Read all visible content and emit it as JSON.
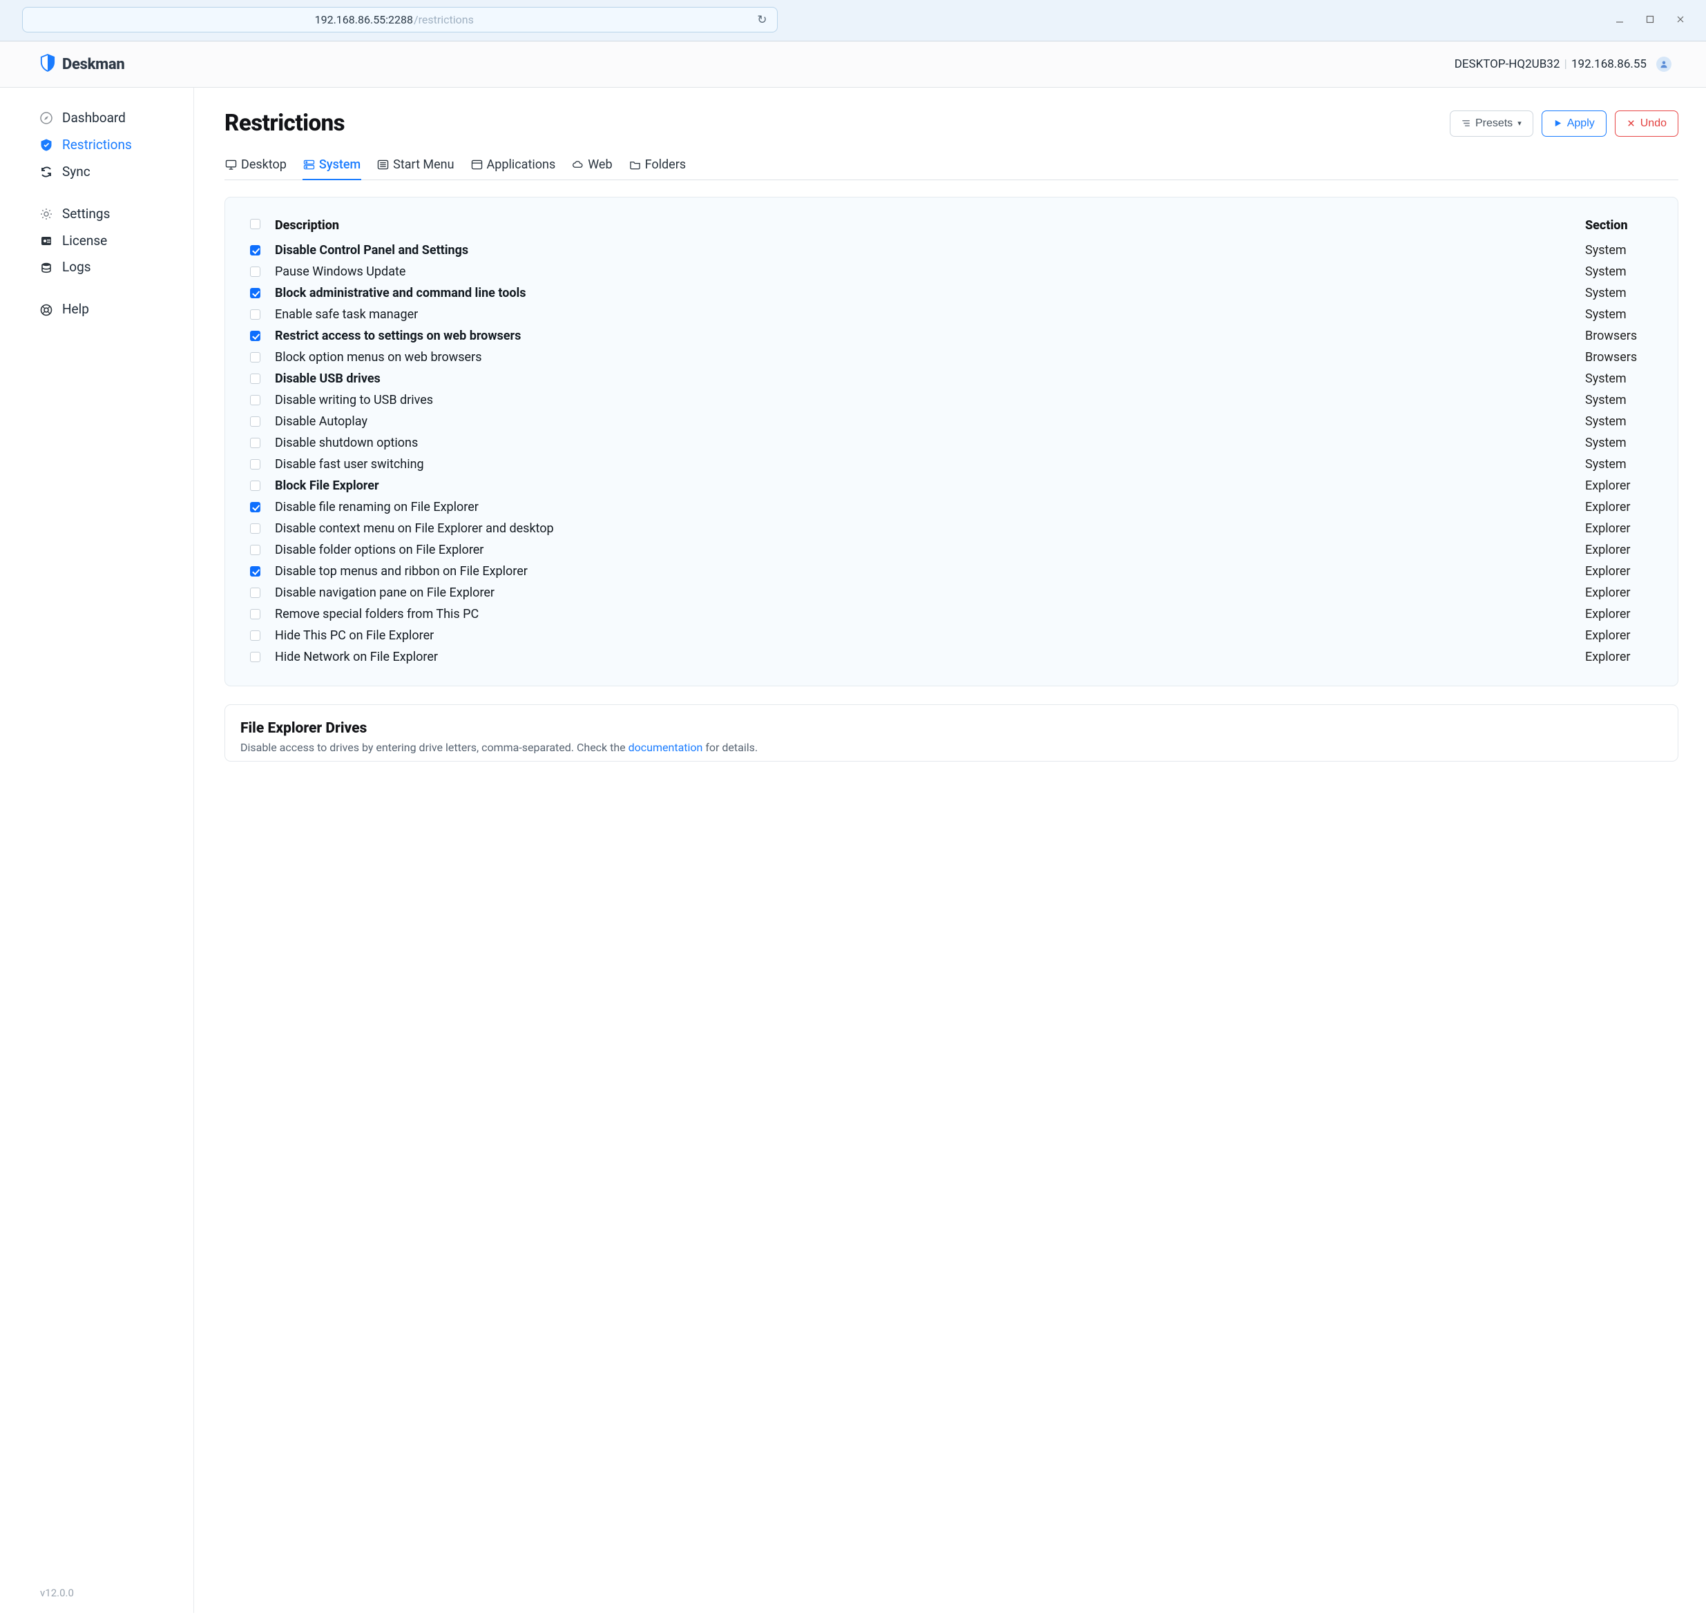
{
  "browser": {
    "url_main": "192.168.86.55:2288",
    "url_path": "/restrictions"
  },
  "brand": "Deskman",
  "host": {
    "name": "DESKTOP-HQ2UB32",
    "ip": "192.168.86.55"
  },
  "sidebar": {
    "items": [
      {
        "label": "Dashboard"
      },
      {
        "label": "Restrictions"
      },
      {
        "label": "Sync"
      },
      {
        "label": "Settings"
      },
      {
        "label": "License"
      },
      {
        "label": "Logs"
      },
      {
        "label": "Help"
      }
    ],
    "version": "v12.0.0"
  },
  "page": {
    "title": "Restrictions",
    "presets_label": "Presets",
    "apply_label": "Apply",
    "undo_label": "Undo"
  },
  "tabs": [
    {
      "label": "Desktop"
    },
    {
      "label": "System"
    },
    {
      "label": "Start Menu"
    },
    {
      "label": "Applications"
    },
    {
      "label": "Web"
    },
    {
      "label": "Folders"
    }
  ],
  "table": {
    "col_desc": "Description",
    "col_sec": "Section",
    "rows": [
      {
        "checked": true,
        "bold": true,
        "desc": "Disable Control Panel and Settings",
        "section": "System"
      },
      {
        "checked": false,
        "bold": false,
        "desc": "Pause Windows Update",
        "section": "System"
      },
      {
        "checked": true,
        "bold": true,
        "desc": "Block administrative and command line tools",
        "section": "System"
      },
      {
        "checked": false,
        "bold": false,
        "desc": "Enable safe task manager",
        "section": "System"
      },
      {
        "checked": true,
        "bold": true,
        "desc": "Restrict access to settings on web browsers",
        "section": "Browsers"
      },
      {
        "checked": false,
        "bold": false,
        "desc": "Block option menus on web browsers",
        "section": "Browsers"
      },
      {
        "checked": false,
        "bold": true,
        "desc": "Disable USB drives",
        "section": "System"
      },
      {
        "checked": false,
        "bold": false,
        "desc": "Disable writing to USB drives",
        "section": "System"
      },
      {
        "checked": false,
        "bold": false,
        "desc": "Disable Autoplay",
        "section": "System"
      },
      {
        "checked": false,
        "bold": false,
        "desc": "Disable shutdown options",
        "section": "System"
      },
      {
        "checked": false,
        "bold": false,
        "desc": "Disable fast user switching",
        "section": "System"
      },
      {
        "checked": false,
        "bold": true,
        "desc": "Block File Explorer",
        "section": "Explorer"
      },
      {
        "checked": true,
        "bold": false,
        "desc": "Disable file renaming on File Explorer",
        "section": "Explorer"
      },
      {
        "checked": false,
        "bold": false,
        "desc": "Disable context menu on File Explorer and desktop",
        "section": "Explorer"
      },
      {
        "checked": false,
        "bold": false,
        "desc": "Disable folder options on File Explorer",
        "section": "Explorer"
      },
      {
        "checked": true,
        "bold": false,
        "desc": "Disable top menus and ribbon on File Explorer",
        "section": "Explorer"
      },
      {
        "checked": false,
        "bold": false,
        "desc": "Disable navigation pane on File Explorer",
        "section": "Explorer"
      },
      {
        "checked": false,
        "bold": false,
        "desc": "Remove special folders from This PC",
        "section": "Explorer"
      },
      {
        "checked": false,
        "bold": false,
        "desc": "Hide This PC on File Explorer",
        "section": "Explorer"
      },
      {
        "checked": false,
        "bold": false,
        "desc": "Hide Network on File Explorer",
        "section": "Explorer"
      }
    ]
  },
  "drives_card": {
    "title": "File Explorer Drives",
    "desc_1": "Disable access to drives by entering drive letters, comma-separated. Check the ",
    "link": "documentation",
    "desc_2": " for details."
  }
}
